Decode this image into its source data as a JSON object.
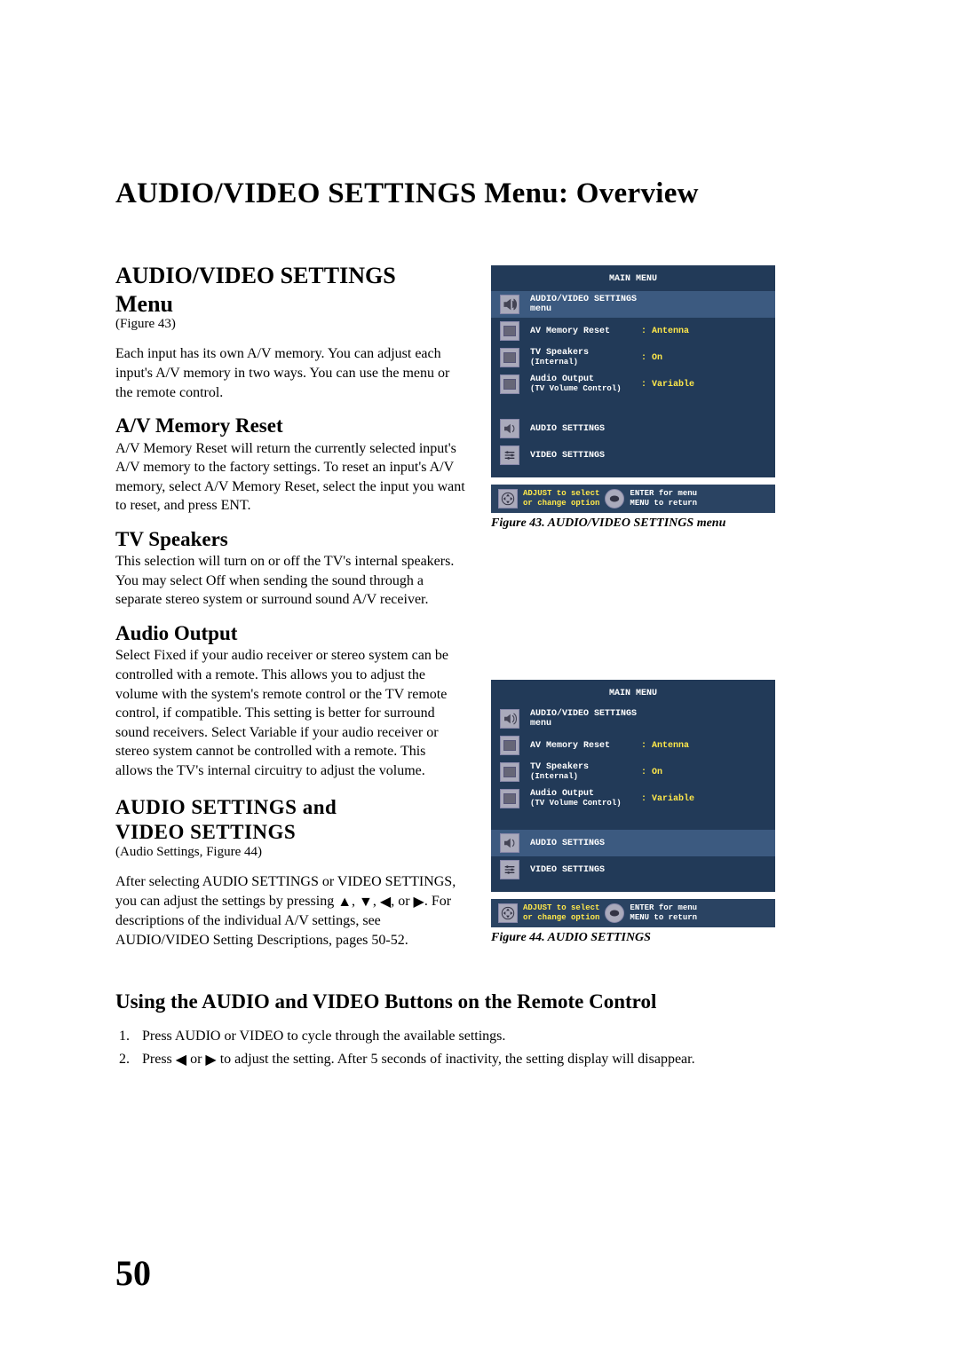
{
  "page_title": "AUDIO/VIDEO SETTINGS Menu: Overview",
  "h2_line1": "AUDIO/VIDEO SETTINGS",
  "h2_line2": "Menu",
  "figref43": "(Figure 43)",
  "intro_body": "Each input has its own A/V memory.  You can adjust each input's A/V memory in two ways.  You can use the menu or the remote control.",
  "sec_av_reset_h": "A/V Memory Reset",
  "sec_av_reset_b": "A/V Memory Reset will return the currently selected input's A/V memory to the factory settings.  To reset an input's A/V memory, select A/V Memory Reset, select the input you want to reset, and press ENT.",
  "sec_tvspk_h": "TV Speakers",
  "sec_tvspk_b": "This selection will turn on or off the TV's internal speakers.  You may select Off when sending the sound through a separate stereo system or surround sound A/V receiver.",
  "sec_audioout_h": "Audio Output",
  "sec_audioout_b": "Select Fixed if your audio receiver or stereo system can be controlled with a remote.  This allows you to adjust the volume with the system's remote control or the TV remote control, if compatible.  This setting is better for surround sound receivers.  Select Variable if your audio receiver or stereo system cannot be controlled with a remote.  This allows the TV's internal circuitry to adjust the volume.",
  "sec_avsettings_h1": "AUDIO SETTINGS  and",
  "sec_avsettings_h2": "VIDEO SETTINGS",
  "figref44": "(Audio Settings, Figure 44)",
  "avsettings_body_a": "After selecting AUDIO SETTINGS or VIDEO SETTINGS, you can adjust the settings by pressing ",
  "avsettings_body_b": ".  For descriptions of the individual A/V settings, see AUDIO/VIDEO Setting Descriptions, pages 50-52.",
  "remote_h": "Using the AUDIO and VIDEO Buttons on the Remote Control",
  "step1": "Press AUDIO or VIDEO to cycle through the  available settings.",
  "step2_a": "Press ",
  "step2_b": " to adjust the setting.  After 5 seconds of inactivity, the setting display will disappear.",
  "or_word": " or ",
  "page_number": "50",
  "osd": {
    "title": "MAIN MENU",
    "item_menu": "AUDIO/VIDEO SETTINGS menu",
    "item_avreset": "AV Memory Reset",
    "val_avreset": ": Antenna",
    "item_tvspk": "TV Speakers",
    "item_tvspk_sub": "(Internal)",
    "val_tvspk": ": On",
    "item_audioout": "Audio Output",
    "item_audioout_sub": "(TV Volume Control)",
    "val_audioout": ": Variable",
    "item_audio": "AUDIO SETTINGS",
    "item_video": "VIDEO SETTINGS",
    "hint_l1": "ADJUST to select",
    "hint_l2": "or change option",
    "hint_r1": "ENTER for menu",
    "hint_r2": "MENU to  return"
  },
  "caption43": "Figure 43. AUDIO/VIDEO SETTINGS menu",
  "caption44": "Figure 44.  AUDIO SETTINGS"
}
